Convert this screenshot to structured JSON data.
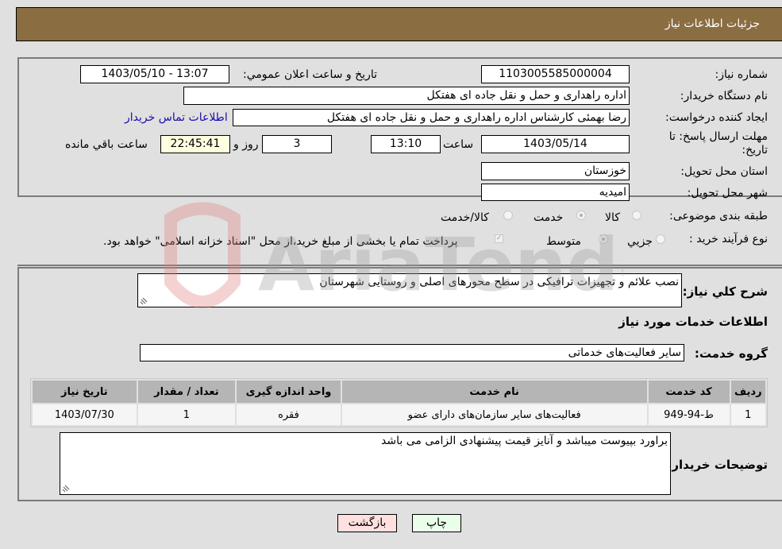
{
  "header": {
    "title": "جزئیات اطلاعات نیاز"
  },
  "fields": {
    "need_number": {
      "label": "شماره نیاز:",
      "value": "1103005585000004"
    },
    "announce_datetime": {
      "label": "تاریخ و ساعت اعلان عمومي:",
      "value": "1403/05/10 - 13:07"
    },
    "buyer_org": {
      "label": "نام دستگاه خریدار:",
      "value": "اداره راهداری و حمل و نقل جاده ای هفتکل"
    },
    "requester": {
      "label": "ایجاد کننده درخواست:",
      "value": "رضا بهمئی کارشناس اداره راهداری و حمل و نقل جاده ای هفتکل"
    },
    "buyer_contact_link": "اطلاعات تماس خریدار",
    "deadline": {
      "label": "مهلت ارسال پاسخ: تا تاریخ:",
      "date": "1403/05/14",
      "time_label": "ساعت",
      "time": "13:10",
      "days": "3",
      "days_label": "روز و",
      "remaining": "22:45:41",
      "remaining_label": "ساعت باقي مانده"
    },
    "province": {
      "label": "استان محل تحویل:",
      "value": "خوزستان"
    },
    "city": {
      "label": "شهر محل تحویل:",
      "value": "امیدیه"
    },
    "category": {
      "label": "طبقه بندی موضوعی:",
      "options": [
        "کالا",
        "خدمت",
        "کالا/خدمت"
      ],
      "selected": "خدمت"
    },
    "purchase_type": {
      "label": "نوع فرآیند خرید :",
      "options": [
        "جزيي",
        "متوسط"
      ],
      "selected": "متوسط",
      "treasury_note": "پرداخت تمام یا بخشی از مبلغ خرید،از محل \"اسناد خزانه اسلامی\" خواهد بود.",
      "treasury_checked": true
    }
  },
  "description": {
    "label": "شرح کلي نیاز:",
    "value": "نصب علائم و تجهیزات ترافیکی در سطح محورهای اصلی و روستایی شهرستان"
  },
  "services_section_title": "اطلاعات خدمات مورد نیاز",
  "service_group": {
    "label": "گروه خدمت:",
    "value": "سایر فعالیت‌های خدماتی"
  },
  "table": {
    "headers": [
      "ردیف",
      "کد خدمت",
      "نام خدمت",
      "واحد اندازه گیری",
      "تعداد / مقدار",
      "تاریخ نیاز"
    ],
    "rows": [
      [
        "1",
        "ط-94-949",
        "فعالیت‌های سایر سازمان‌های دارای عضو",
        "فقره",
        "1",
        "1403/07/30"
      ]
    ]
  },
  "buyer_notes": {
    "label": "توضیحات خریدار:",
    "value": "براورد بپیوست میباشد و آنایز قیمت پیشنهادی الزامی می باشد"
  },
  "buttons": {
    "print": "چاپ",
    "back": "بازگشت"
  },
  "colors": {
    "header_bg": "#8b6d42",
    "print_bg": "#eaffea",
    "back_bg": "#ffe0e0",
    "link": "#1a0dab"
  },
  "watermark": "AriaTender.neT"
}
